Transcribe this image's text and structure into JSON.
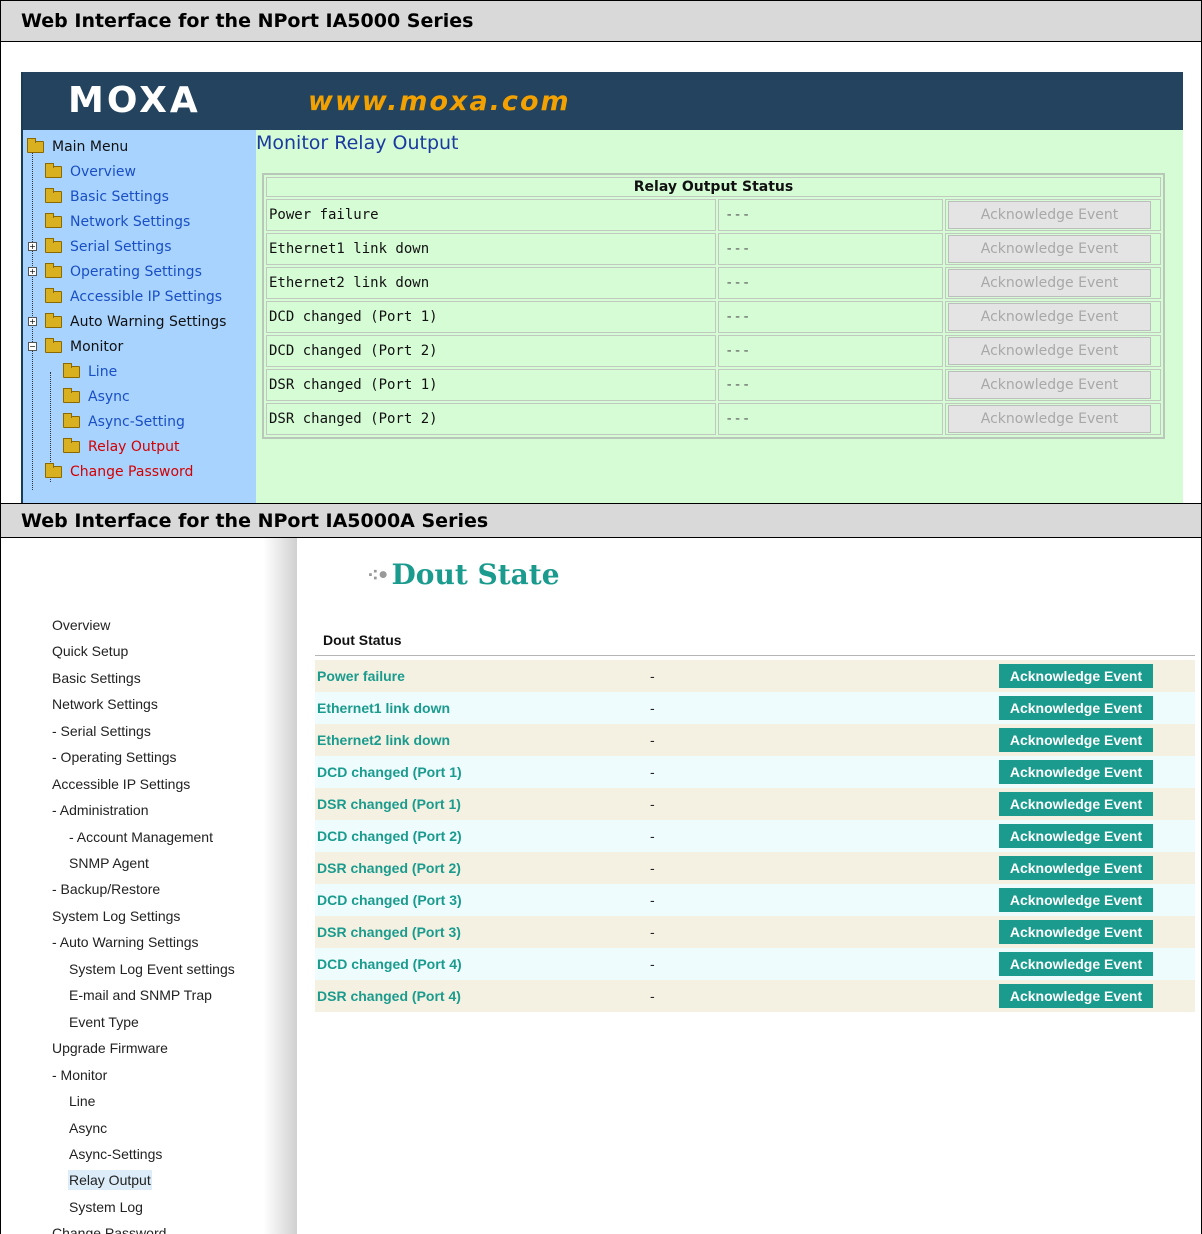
{
  "sections": {
    "ia5000_header": "Web Interface for the NPort IA5000 Series",
    "ia5000a_header": "Web Interface for the NPort IA5000A Series"
  },
  "ia5000": {
    "logo_text": "MOXA",
    "url": "www.moxa.com",
    "colors": {
      "banner": "#23435e",
      "sidebar": "#a8d3ff",
      "main": "#d6fcd6",
      "url": "#f2a100"
    },
    "menu": {
      "main_menu": "Main Menu",
      "overview": "Overview",
      "basic_settings": "Basic Settings",
      "network_settings": "Network Settings",
      "serial_settings": "Serial Settings",
      "operating_settings": "Operating Settings",
      "accessible_ip_settings": "Accessible IP Settings",
      "auto_warning_settings": "Auto Warning Settings",
      "monitor": "Monitor",
      "line": "Line",
      "async": "Async",
      "async_setting": "Async-Setting",
      "relay_output": "Relay Output",
      "change_password": "Change Password"
    },
    "page_title": "Monitor Relay Output",
    "table_header": "Relay Output Status",
    "rows": [
      {
        "event": "Power failure",
        "status": "---",
        "button": "Acknowledge Event"
      },
      {
        "event": "Ethernet1 link down",
        "status": "---",
        "button": "Acknowledge Event"
      },
      {
        "event": "Ethernet2 link down",
        "status": "---",
        "button": "Acknowledge Event"
      },
      {
        "event": "DCD changed (Port 1)",
        "status": "---",
        "button": "Acknowledge Event"
      },
      {
        "event": "DCD changed (Port 2)",
        "status": "---",
        "button": "Acknowledge Event"
      },
      {
        "event": "DSR changed (Port 1)",
        "status": "---",
        "button": "Acknowledge Event"
      },
      {
        "event": "DSR changed (Port 2)",
        "status": "---",
        "button": "Acknowledge Event"
      }
    ]
  },
  "ia5000a": {
    "colors": {
      "accent": "#1a9b8e",
      "row_odd": "#f5f1e2",
      "row_even": "#eefcfe",
      "active_menu": "#dcedf9"
    },
    "menu": [
      "Overview",
      "Quick Setup",
      "Basic Settings",
      "Network Settings",
      "- Serial Settings",
      "- Operating Settings",
      "Accessible IP Settings",
      "- Administration",
      "- Account Management",
      "SNMP Agent",
      "- Backup/Restore",
      "System Log Settings",
      "- Auto Warning Settings",
      "System Log Event settings",
      "E-mail and SNMP Trap",
      "Event Type",
      "Upgrade Firmware",
      "- Monitor",
      "Line",
      "Async",
      "Async-Settings",
      "Relay Output",
      "System Log",
      "Change Password"
    ],
    "page_title": "Dout State",
    "section_title": "Dout Status",
    "rows": [
      {
        "event": "Power failure",
        "status": "-",
        "button": "Acknowledge Event"
      },
      {
        "event": "Ethernet1 link down",
        "status": "-",
        "button": "Acknowledge Event"
      },
      {
        "event": "Ethernet2 link down",
        "status": "-",
        "button": "Acknowledge Event"
      },
      {
        "event": "DCD changed (Port 1)",
        "status": "-",
        "button": "Acknowledge Event"
      },
      {
        "event": "DSR changed (Port 1)",
        "status": "-",
        "button": "Acknowledge Event"
      },
      {
        "event": "DCD changed (Port 2)",
        "status": "-",
        "button": "Acknowledge Event"
      },
      {
        "event": "DSR changed (Port 2)",
        "status": "-",
        "button": "Acknowledge Event"
      },
      {
        "event": "DCD changed (Port 3)",
        "status": "-",
        "button": "Acknowledge Event"
      },
      {
        "event": "DSR changed (Port 3)",
        "status": "-",
        "button": "Acknowledge Event"
      },
      {
        "event": "DCD changed (Port 4)",
        "status": "-",
        "button": "Acknowledge Event"
      },
      {
        "event": "DSR changed (Port 4)",
        "status": "-",
        "button": "Acknowledge Event"
      }
    ]
  }
}
